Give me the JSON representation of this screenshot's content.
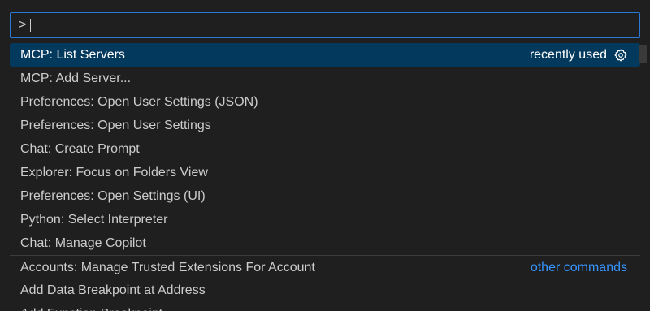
{
  "input": {
    "value": ">",
    "placeholder": ""
  },
  "items": [
    {
      "label": "MCP: List Servers",
      "meta": "recently used",
      "icon": "gear-icon"
    },
    {
      "label": "MCP: Add Server..."
    },
    {
      "label": "Preferences: Open User Settings (JSON)"
    },
    {
      "label": "Preferences: Open User Settings"
    },
    {
      "label": "Chat: Create Prompt"
    },
    {
      "label": "Explorer: Focus on Folders View"
    },
    {
      "label": "Preferences: Open Settings (UI)"
    },
    {
      "label": "Python: Select Interpreter"
    },
    {
      "label": "Chat: Manage Copilot"
    },
    {
      "label": "Accounts: Manage Trusted Extensions For Account",
      "meta": "other commands"
    },
    {
      "label": "Add Data Breakpoint at Address"
    },
    {
      "label": "Add Function Breakpoint"
    }
  ],
  "colors": {
    "background": "#1f1f1f",
    "active_row": "#04395e",
    "focus_border": "#2b79d7",
    "link": "#3794ff",
    "text": "#cccccc"
  }
}
